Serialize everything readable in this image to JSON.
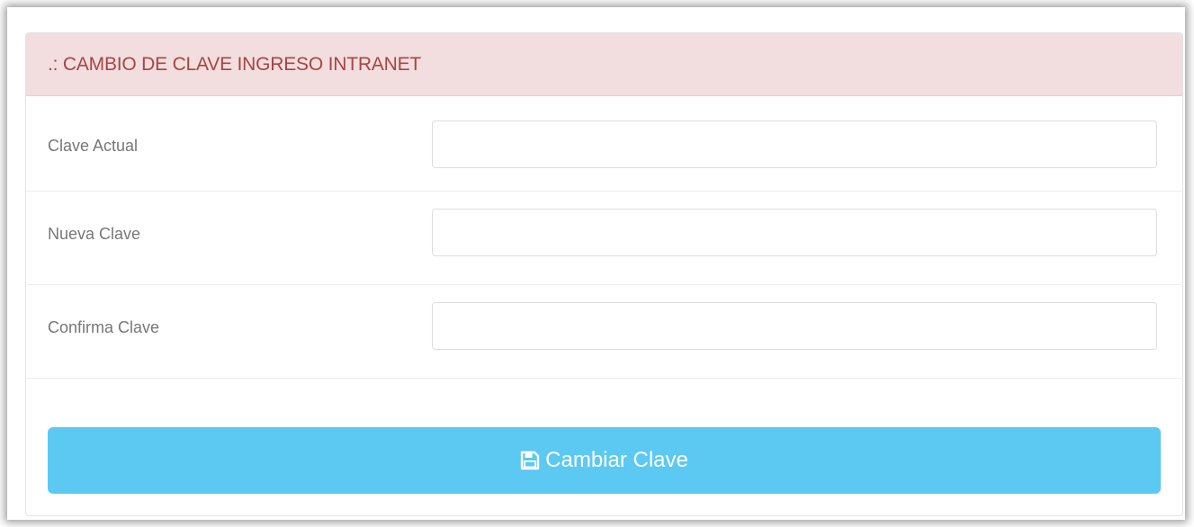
{
  "panel": {
    "title": ".: CAMBIO DE CLAVE INGRESO INTRANET"
  },
  "form": {
    "fields": [
      {
        "label": "Clave Actual",
        "value": "",
        "placeholder": ""
      },
      {
        "label": "Nueva Clave",
        "value": "",
        "placeholder": ""
      },
      {
        "label": "Confirma Clave",
        "value": "",
        "placeholder": ""
      }
    ],
    "submit_label": "Cambiar Clave",
    "submit_icon": "save-icon"
  },
  "colors": {
    "heading_bg": "#f2dede",
    "heading_text": "#a94442",
    "button_bg": "#5bc9f2"
  }
}
